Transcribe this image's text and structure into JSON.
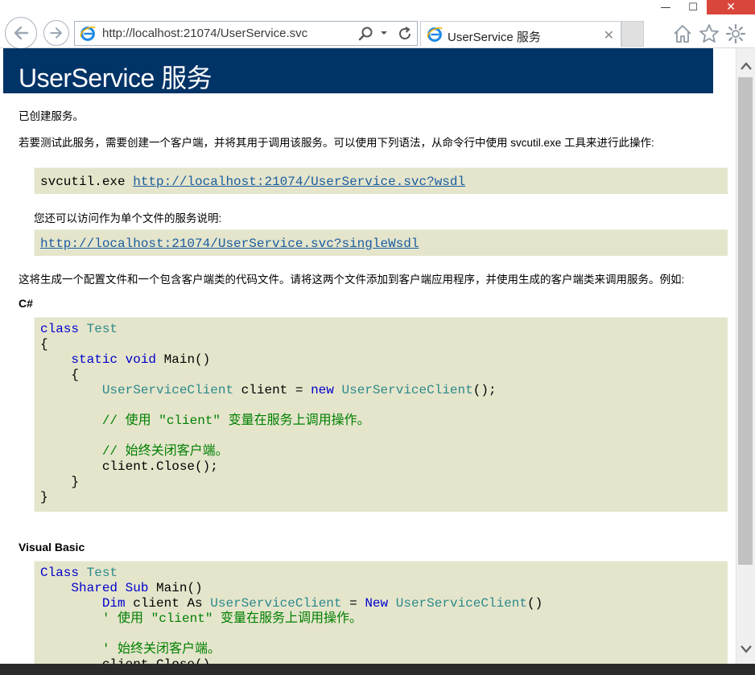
{
  "browser": {
    "url": "http://localhost:21074/UserService.svc",
    "tab_title": "UserService 服务",
    "tab_close": "✕",
    "win_min": "—",
    "win_max": "☐",
    "win_close": "✕"
  },
  "page": {
    "header_title": "UserService 服务",
    "created": "已创建服务。",
    "intro": "若要测试此服务，需要创建一个客户端，并将其用于调用该服务。可以使用下列语法，从命令行中使用 svcutil.exe 工具来进行此操作:",
    "svcutil_cmd": "svcutil.exe",
    "wsdl_link": "http://localhost:21074/UserService.svc?wsdl",
    "single_file_note": "您还可以访问作为单个文件的服务说明:",
    "single_wsdl_link": "http://localhost:21074/UserService.svc?singleWsdl",
    "generate_note": "这将生成一个配置文件和一个包含客户端类的代码文件。请将这两个文件添加到客户端应用程序，并使用生成的客户端类来调用服务。例如:",
    "csharp_heading": "C#",
    "vb_heading": "Visual Basic",
    "code": {
      "cs_class_kw": "class",
      "cs_class_name": "Test",
      "open_brace": "{",
      "close_brace": "}",
      "cs_static_void": "static void",
      "cs_main": "Main()",
      "cs_client_type": "UserServiceClient",
      "cs_client_decl": "client =",
      "cs_new": "new",
      "cs_ctor_tail": "();",
      "cs_comment_use": "// 使用 \"client\" 变量在服务上调用操作。",
      "cs_comment_close": "// 始终关闭客户端。",
      "cs_close_call": "client.Close();",
      "vb_class_kw": "Class",
      "vb_class_name": "Test",
      "vb_shared_sub": "Shared Sub",
      "vb_main": "Main()",
      "vb_dim": "Dim",
      "vb_client_as": "client As",
      "vb_client_type": "UserServiceClient",
      "vb_eq": "=",
      "vb_new": "New",
      "vb_ctor_tail": "()",
      "vb_comment_use": "' 使用 \"client\" 变量在服务上调用操作。",
      "vb_comment_close": "' 始终关闭客户端。",
      "vb_close_call": "client.Close()"
    }
  },
  "icons": {
    "back": "back-arrow-icon",
    "forward": "forward-arrow-icon",
    "search": "search-icon",
    "dropdown": "chevron-down-icon",
    "refresh": "refresh-icon",
    "home": "home-icon",
    "favorites": "star-icon",
    "settings": "gear-icon"
  },
  "colors": {
    "header_bg": "#003366",
    "code_bg": "#e5e5cc",
    "keyword": "#0000cc",
    "type": "#2b8a8a",
    "comment": "#008000",
    "link": "#1a5da0",
    "close_button": "#d9463b"
  }
}
